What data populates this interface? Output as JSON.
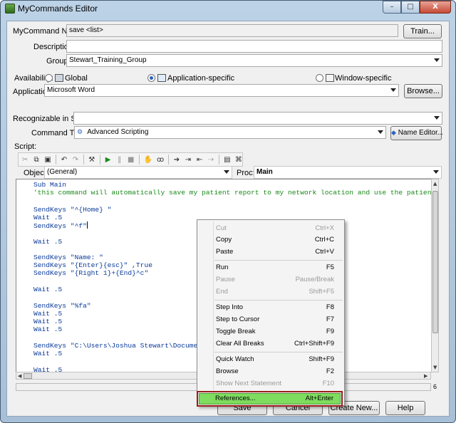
{
  "window": {
    "title": "MyCommands Editor",
    "controls": [
      "–",
      "□",
      "X"
    ]
  },
  "form": {
    "name_label": "MyCommand Name:",
    "name_value": "save <list>",
    "train_button": "Train...",
    "description_label": "Description:",
    "description_value": "",
    "group_label": "Group:",
    "group_value": "Stewart_Training_Group",
    "availability_label": "Availability:",
    "availability_options": [
      "Global",
      "Application-specific",
      "Window-specific"
    ],
    "availability_selected": "Application-specific",
    "application_label": "Application:",
    "application_value": "Microsoft Word",
    "browse_button": "Browse...",
    "states_label": "Recognizable in States:",
    "states_value": "",
    "command_type_label": "Command Type:",
    "command_type_value": "Advanced Scripting",
    "name_editor_button": "Name Editor...",
    "script_label": "Script:",
    "object_label": "Object:",
    "object_value": "(General)",
    "proc_label": "Proc:",
    "proc_value": "Main"
  },
  "script_lines": [
    {
      "text": "Sub Main",
      "kind": "code"
    },
    {
      "text": "'this command will automatically save my patient report to my network location and use the patient name as",
      "kind": "comment"
    },
    {
      "text": "SendKeys \"^{Home} \"",
      "kind": "code"
    },
    {
      "text": "Wait .5",
      "kind": "code"
    },
    {
      "text": "SendKeys \"^f\"",
      "kind": "code"
    },
    {
      "text": "Wait .5",
      "kind": "code"
    },
    {
      "text": "SendKeys \"Name: \"",
      "kind": "code"
    },
    {
      "text": "SendKeys \"{Enter}{esc}\" ,True",
      "kind": "code"
    },
    {
      "text": "SendKeys \"{Right 1}+{End}^c\"",
      "kind": "code"
    },
    {
      "text": "Wait .5",
      "kind": "code"
    },
    {
      "text": "SendKeys \"%fa\"",
      "kind": "code"
    },
    {
      "text": "Wait .5",
      "kind": "code"
    },
    {
      "text": "Wait .5",
      "kind": "code"
    },
    {
      "text": "Wait .5",
      "kind": "code"
    },
    {
      "text": "SendKeys \"C:\\Users\\Joshua Stewart\\Documents\\",
      "kind": "code"
    },
    {
      "text": "Wait .5",
      "kind": "code"
    },
    {
      "text": "Wait .5",
      "kind": "code"
    }
  ],
  "status_line_number": "6",
  "bottom_buttons": {
    "save": "Save",
    "cancel": "Cancel",
    "create_new": "Create New...",
    "help": "Help"
  },
  "context_menu": {
    "items": [
      {
        "label": "Cut",
        "shortcut": "Ctrl+X",
        "enabled": false
      },
      {
        "label": "Copy",
        "shortcut": "Ctrl+C",
        "enabled": true
      },
      {
        "label": "Paste",
        "shortcut": "Ctrl+V",
        "enabled": true
      },
      {
        "label": "Run",
        "shortcut": "F5",
        "enabled": true
      },
      {
        "label": "Pause",
        "shortcut": "Pause/Break",
        "enabled": false
      },
      {
        "label": "End",
        "shortcut": "Shift+F5",
        "enabled": false
      },
      {
        "label": "Step Into",
        "shortcut": "F8",
        "enabled": true
      },
      {
        "label": "Step to Cursor",
        "shortcut": "F7",
        "enabled": true
      },
      {
        "label": "Toggle Break",
        "shortcut": "F9",
        "enabled": true
      },
      {
        "label": "Clear All Breaks",
        "shortcut": "Ctrl+Shift+F9",
        "enabled": true
      },
      {
        "label": "Quick Watch",
        "shortcut": "Shift+F9",
        "enabled": true
      },
      {
        "label": "Browse",
        "shortcut": "F2",
        "enabled": true
      },
      {
        "label": "Show Next Statement",
        "shortcut": "F10",
        "enabled": false
      },
      {
        "label": "References...",
        "shortcut": "Alt+Enter",
        "enabled": true
      }
    ],
    "highlighted_color": "#7edc5e",
    "highlight_frame_color": "#9a1c1c"
  }
}
